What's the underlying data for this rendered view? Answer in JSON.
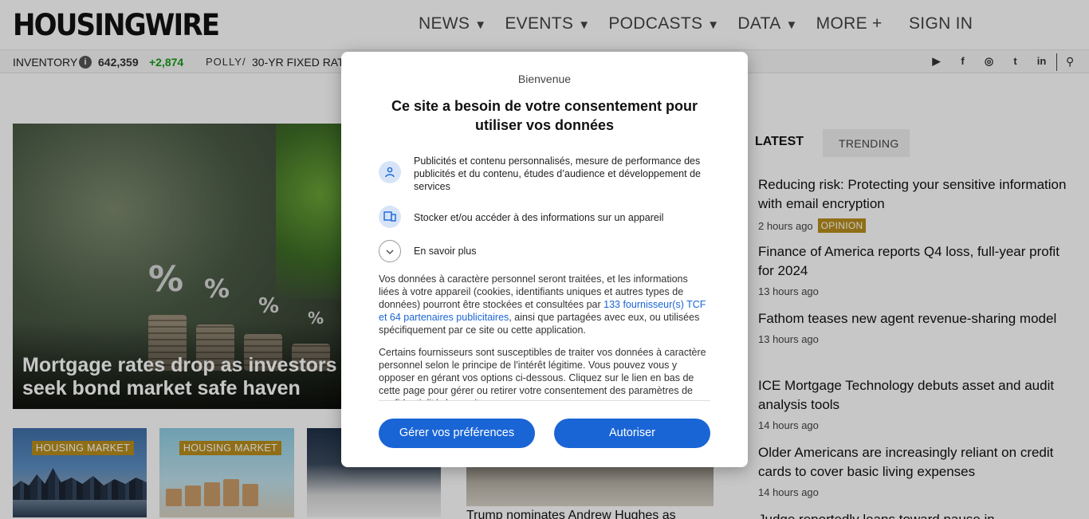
{
  "header": {
    "logo": "HOUSINGWIRE",
    "nav": [
      {
        "label": "NEWS",
        "arrow": "▼"
      },
      {
        "label": "EVENTS",
        "arrow": "▼"
      },
      {
        "label": "PODCASTS",
        "arrow": "▼"
      },
      {
        "label": "DATA",
        "arrow": "▼"
      },
      {
        "label": "MORE +",
        "arrow": ""
      }
    ],
    "signin": "SIGN IN"
  },
  "ticker": {
    "label": "INVENTORY",
    "info": "i",
    "value": "642,359",
    "change": "+2,874",
    "polly": "POLLY/",
    "rate_label": "30-YR FIXED RAT",
    "social": [
      {
        "icon": "youtube-icon",
        "glyph": "▶"
      },
      {
        "icon": "facebook-icon",
        "glyph": "f"
      },
      {
        "icon": "instagram-icon",
        "glyph": "◎"
      },
      {
        "icon": "twitter-icon",
        "glyph": "t"
      },
      {
        "icon": "linkedin-icon",
        "glyph": "in"
      }
    ],
    "search_glyph": "⚲"
  },
  "hero": {
    "title": "Mortgage rates drop as investors seek bond market safe haven",
    "colors": {
      "tag": "#b88e1d"
    }
  },
  "thumbs": [
    {
      "tag": "HOUSING MARKET"
    },
    {
      "tag": "HOUSING MARKET"
    },
    {
      "tag": ""
    }
  ],
  "mid": {
    "caption": "Trump nominates Andrew Hughes as"
  },
  "sidebar": {
    "tabs": {
      "latest": "LATEST",
      "trending": "TRENDING"
    },
    "articles": [
      {
        "title": "Reducing risk: Protecting your sensitive information with email encryption",
        "time": "2 hours ago",
        "badge": "OPINION"
      },
      {
        "title": "Finance of America reports Q4 loss, full-year profit for 2024",
        "time": "13 hours ago",
        "badge": ""
      },
      {
        "title": "Fathom teases new agent revenue-sharing model",
        "time": "13 hours ago",
        "badge": ""
      },
      {
        "title": "ICE Mortgage Technology debuts asset and audit analysis tools",
        "time": "14 hours ago",
        "badge": ""
      },
      {
        "title": "Older Americans are increasingly reliant on credit cards to cover basic living expenses",
        "time": "14 hours ago",
        "badge": ""
      },
      {
        "title": "Judge reportedly leans toward pause in",
        "time": "",
        "badge": ""
      }
    ]
  },
  "consent": {
    "welcome": "Bienvenue",
    "title": "Ce site a besoin de votre consentement pour utiliser vos données",
    "purpose1": "Publicités et contenu personnalisés, mesure de performance des publicités et du contenu, études d’audience et développement de services",
    "purpose2": "Stocker et/ou accéder à des informations sur un appareil",
    "more": "En savoir plus",
    "para1_a": "Vos données à caractère personnel seront traitées, et les informations liées à votre appareil (cookies, identifiants uniques et autres types de données) pourront être stockées et consultées par ",
    "para1_link": "133 fournisseur(s) TCF et 64 partenaires publicitaires",
    "para1_b": ", ainsi que partagées avec eux, ou utilisées spécifiquement par ce site ou cette application.",
    "para2": "Certains fournisseurs sont susceptibles de traiter vos données à caractère personnel selon le principe de l'intérêt légitime. Vous pouvez vous y opposer en gérant vos options ci-dessous. Cliquez sur le lien en bas de cette page pour gérer ou retirer votre consentement des paramètres de confidentialité de ce site.",
    "btn_prefs": "Gérer vos préférences",
    "btn_allow": "Autoriser",
    "accent": "#1a65d6"
  }
}
